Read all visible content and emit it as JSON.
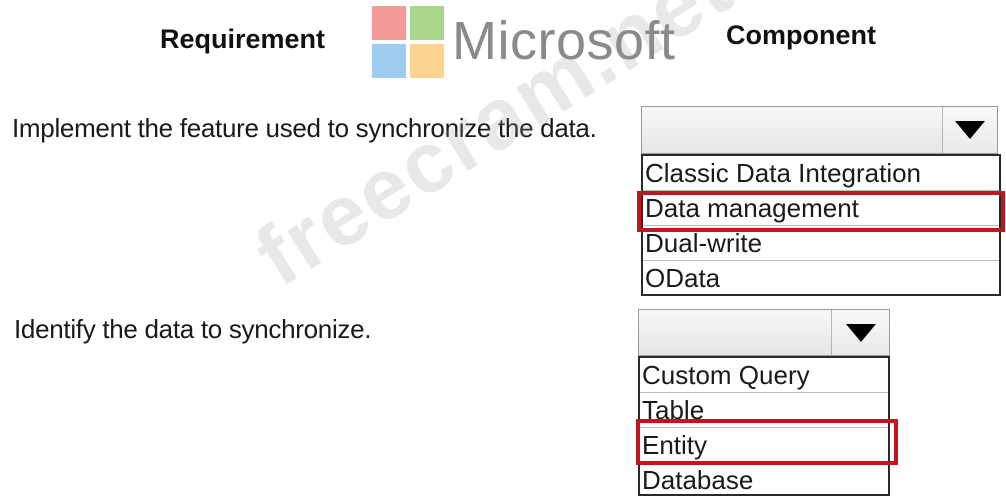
{
  "headers": {
    "requirement": "Requirement",
    "component": "Component"
  },
  "logo": {
    "text": "Microsoft",
    "colors": [
      "#f25022",
      "#7fba00",
      "#00a4ef",
      "#ffb900"
    ]
  },
  "watermark": "freecram.net",
  "rows": [
    {
      "requirement": "Implement the feature used to synchronize the data.",
      "options": [
        "Classic Data Integration",
        "Data management",
        "Dual-write",
        "OData"
      ],
      "selected": "Data management"
    },
    {
      "requirement": "Identify the data to synchronize.",
      "options": [
        "Custom Query",
        "Table",
        "Entity",
        "Database"
      ],
      "selected": "Entity"
    }
  ],
  "colors": {
    "selection_border": "#c0161f"
  }
}
